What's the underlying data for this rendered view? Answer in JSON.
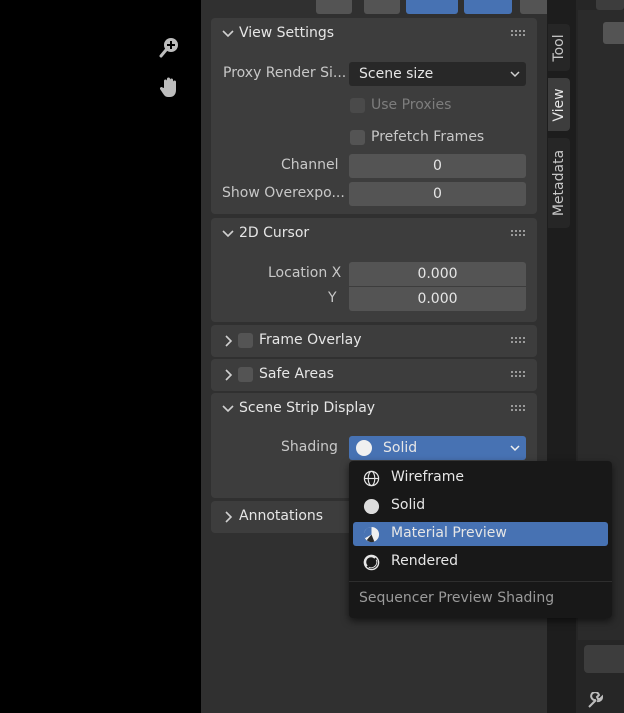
{
  "sidebar": {
    "view_settings": {
      "title": "View Settings",
      "proxy_render_size_label": "Proxy Render Si...",
      "proxy_render_size_value": "Scene size",
      "use_proxies_label": "Use Proxies",
      "prefetch_frames_label": "Prefetch Frames",
      "channel_label": "Channel",
      "channel_value": "0",
      "show_overexposed_label": "Show Overexpo...",
      "show_overexposed_value": "0"
    },
    "cursor_2d": {
      "title": "2D Cursor",
      "location_x_label": "Location X",
      "location_x_value": "0.000",
      "y_label": "Y",
      "y_value": "0.000"
    },
    "frame_overlay": {
      "title": "Frame Overlay"
    },
    "safe_areas": {
      "title": "Safe Areas"
    },
    "scene_strip_display": {
      "title": "Scene Strip Display",
      "shading_label": "Shading",
      "shading_value": "Solid"
    },
    "annotations": {
      "title": "Annotations"
    }
  },
  "tabs": [
    "Tool",
    "View",
    "Metadata"
  ],
  "shading_menu": {
    "items": [
      {
        "label": "Wireframe",
        "icon": "wireframe-shading-icon"
      },
      {
        "label": "Solid",
        "icon": "solid-shading-icon"
      },
      {
        "label": "Material Preview",
        "icon": "material-preview-icon"
      },
      {
        "label": "Rendered",
        "icon": "rendered-shading-icon"
      }
    ],
    "highlighted": "Material Preview",
    "footer": "Sequencer Preview Shading"
  },
  "colors": {
    "viewport": "#000000",
    "panel": "#3d3d3d",
    "field": "#545454",
    "accent": "#4772b3",
    "menu": "#181818"
  }
}
